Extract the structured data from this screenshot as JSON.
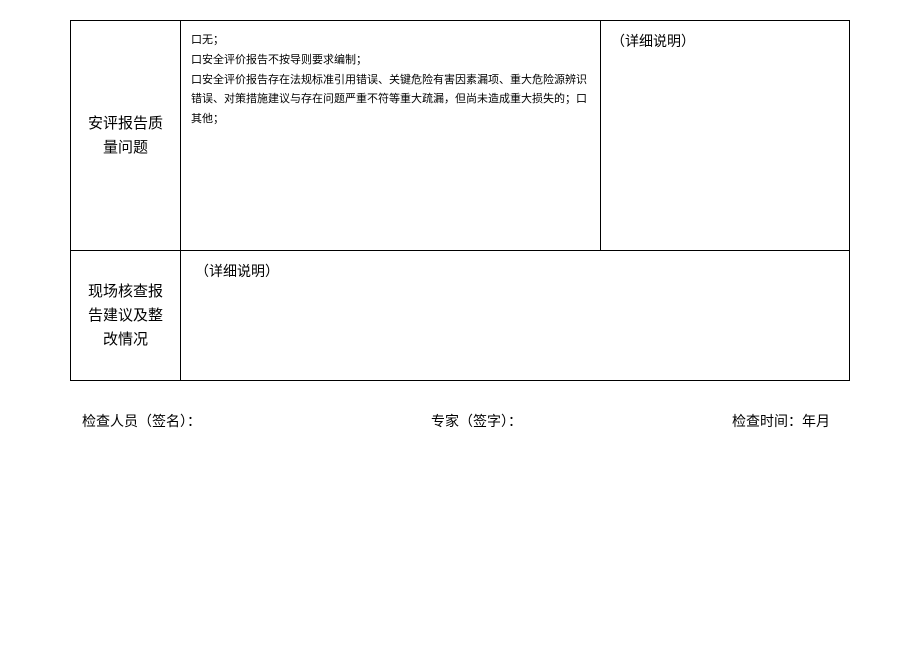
{
  "row1": {
    "label": "安评报告质量问题",
    "checkbox_lines": {
      "line1": "口无；",
      "line2": "口安全评价报告不按导则要求编制；",
      "line3": "口安全评价报告存在法规标准引用错误、关键危险有害因素漏项、重大危险源辨识错误、对策措施建议与存在问题严重不符等重大疏漏，但尚未造成重大损失的；口其他；"
    },
    "detail": "（详细说明）"
  },
  "row2": {
    "label": "现场核查报告建议及整改情况",
    "detail": "（详细说明）"
  },
  "signatures": {
    "inspector": "检查人员（签名）：",
    "expert": "专家（签字）：",
    "time": "检查时间：年月"
  }
}
